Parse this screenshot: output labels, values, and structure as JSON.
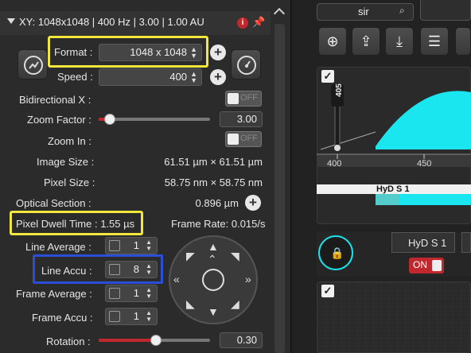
{
  "panel": {
    "title": "XY: 1048x1048 | 400 Hz | 3.00 | 1.00 AU",
    "info_glyph": "i"
  },
  "format": {
    "label": "Format :",
    "value": "1048 x 1048"
  },
  "speed": {
    "label": "Speed :",
    "value": "400"
  },
  "bidirectional": {
    "label": "Bidirectional X :",
    "state": "OFF"
  },
  "zoom_factor": {
    "label": "Zoom Factor :",
    "value": "3.00",
    "level": 0.1
  },
  "zoom_in": {
    "label": "Zoom In :",
    "state": "OFF"
  },
  "image_size": {
    "label": "Image Size :",
    "value": "61.51 µm × 61.51 µm"
  },
  "pixel_size": {
    "label": "Pixel Size :",
    "value": "58.75 nm × 58.75 nm"
  },
  "optical_section": {
    "label": "Optical Section :",
    "value": "0.896 µm"
  },
  "pixel_dwell": {
    "label": "Pixel Dwell Time : 1.55 µs"
  },
  "frame_rate": {
    "label": "Frame Rate: 0.015/s"
  },
  "line_average": {
    "label": "Line Average :",
    "value": "1"
  },
  "line_accu": {
    "label": "Line Accu :",
    "value": "8"
  },
  "frame_average": {
    "label": "Frame Average :",
    "value": "1"
  },
  "frame_accu": {
    "label": "Frame Accu :",
    "value": "1"
  },
  "rotation": {
    "label": "Rotation :",
    "value": "0.30",
    "level": 0.52
  },
  "search": {
    "value": "sir"
  },
  "spectrum": {
    "marker": "405",
    "ticks": [
      "400",
      "450"
    ],
    "detector": "HyD S 1",
    "fill_color": "#19e6ee"
  },
  "detector_card": {
    "name": "HyD S 1",
    "state": "ON"
  },
  "colors": {
    "accent_cyan": "#19e6ee",
    "highlight_yellow": "#f2e73a",
    "highlight_blue": "#2b4ed8",
    "on_red": "#c0282d"
  }
}
